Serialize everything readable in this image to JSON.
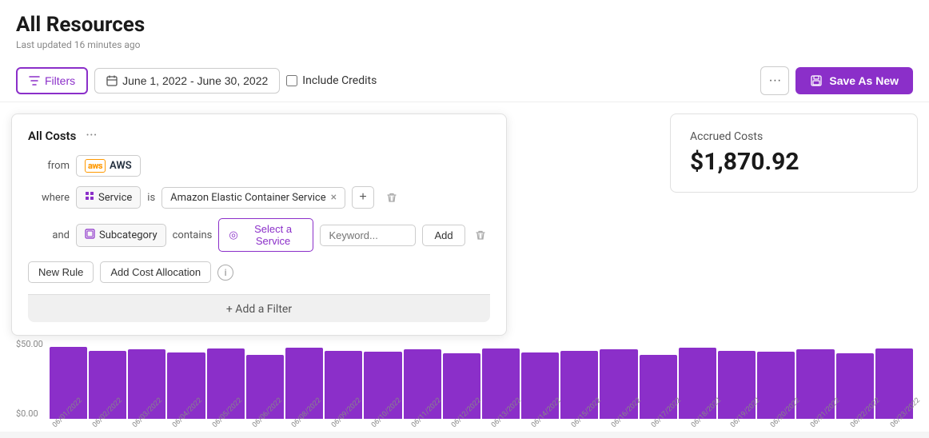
{
  "page": {
    "title": "All Resources",
    "last_updated": "Last updated 16 minutes ago"
  },
  "toolbar": {
    "filter_label": "Filters",
    "date_range": "June 1, 2022 - June 30, 2022",
    "include_credits_label": "Include Credits",
    "more_label": "···",
    "save_as_new_label": "Save As New"
  },
  "filter_panel": {
    "title": "All Costs",
    "menu_label": "···",
    "from_label": "from",
    "where_label": "where",
    "and_label": "and",
    "aws_label": "AWS",
    "service_tag_label": "Service",
    "is_label": "is",
    "service_value": "Amazon Elastic Container Service",
    "subcategory_label": "Subcategory",
    "contains_label": "contains",
    "select_service_label": "Select a Service",
    "keyword_placeholder": "Keyword...",
    "add_label": "Add",
    "new_rule_label": "New Rule",
    "add_cost_allocation_label": "Add Cost Allocation",
    "add_filter_label": "+ Add a Filter"
  },
  "accrued": {
    "label": "Accrued Costs",
    "value": "$1,870.92"
  },
  "chart": {
    "y_top": "$50.00",
    "y_bottom": "$0.00",
    "bars": [
      85,
      80,
      82,
      78,
      83,
      76,
      84,
      80,
      79,
      82,
      77,
      83,
      78,
      80,
      82,
      76,
      84,
      80,
      79,
      82,
      77,
      83
    ],
    "x_labels": [
      "06/01/2022",
      "06/02/2022",
      "06/03/2022",
      "06/04/2022",
      "06/05/2022",
      "06/06/2022",
      "06/08/2022",
      "06/09/2022",
      "06/10/2022",
      "06/11/2022",
      "06/12/2022",
      "06/13/2022",
      "06/14/2022",
      "06/15/2022",
      "06/16/2022",
      "06/17/2022",
      "06/18/2022",
      "06/19/2022",
      "06/20/2022",
      "06/21/2022",
      "06/22/2022",
      "06/23/2022"
    ]
  },
  "icons": {
    "filter": "⊤",
    "calendar": "🗓",
    "save": "💾",
    "grid": "⊞",
    "subcategory": "⊟",
    "service_select": "◎",
    "info": "i"
  }
}
